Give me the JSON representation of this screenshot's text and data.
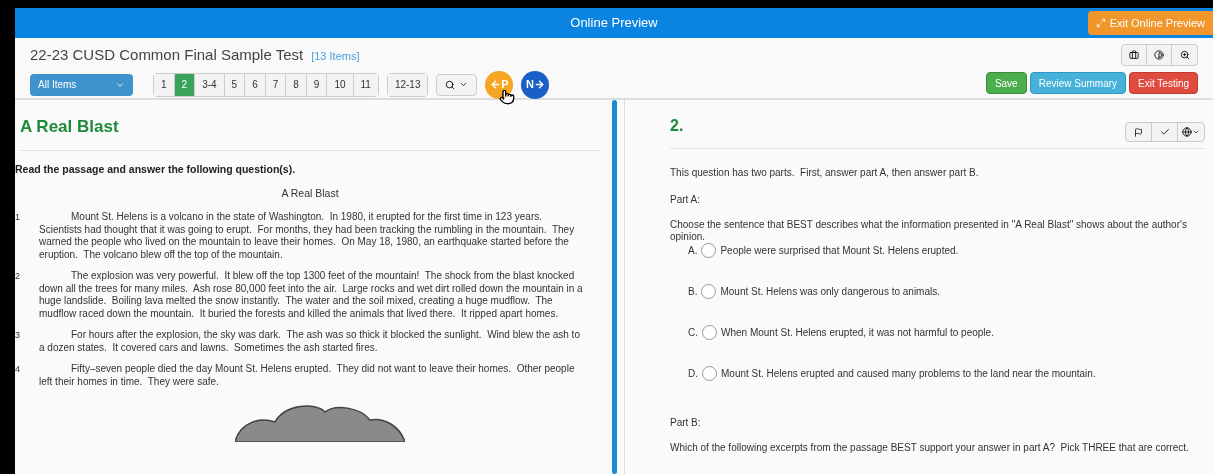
{
  "header": {
    "title": "Online Preview",
    "exit_button": "Exit Online Preview"
  },
  "test": {
    "title": "22-23 CUSD Common Final Sample Test",
    "count": "[13 Items]"
  },
  "filter": {
    "label": "All Items"
  },
  "pages": [
    {
      "label": "1",
      "selected": false
    },
    {
      "label": "2",
      "selected": true
    },
    {
      "label": "3-4",
      "selected": false
    },
    {
      "label": "5",
      "selected": false
    },
    {
      "label": "6",
      "selected": false
    },
    {
      "label": "7",
      "selected": false
    },
    {
      "label": "8",
      "selected": false
    },
    {
      "label": "9",
      "selected": false
    },
    {
      "label": "10",
      "selected": false
    },
    {
      "label": "11",
      "selected": false
    }
  ],
  "pages_extra": {
    "label": "12-13",
    "selected": false
  },
  "nav": {
    "prev": "P",
    "next": "N"
  },
  "actions": [
    {
      "label": "Save",
      "kind": "save"
    },
    {
      "label": "Review Summary",
      "kind": "review"
    },
    {
      "label": "Exit Testing",
      "kind": "exit"
    }
  ],
  "passage": {
    "heading": "A Real Blast",
    "instruction": "Read the passage and answer the following question(s).",
    "title": "A Real Blast",
    "paragraphs": [
      {
        "number": "1",
        "text": "Mount St. Helens is a volcano in the state of Washington.  In 1980, it erupted for the first time in 123 years.  Scientists had thought that it was going to erupt.  For months, they had been tracking the rumbling in the mountain.  They warned the people who lived on the mountain to leave their homes.  On May 18, 1980, an earthquake started before the eruption.  The volcano blew off the top of the mountain."
      },
      {
        "number": "2",
        "text": "The explosion was very powerful.  It blew off the top 1300 feet of the mountain!  The shock from the blast knocked down all the trees for many miles.  Ash rose 80,000 feet into the air.  Large rocks and wet dirt rolled down the mountain in a huge landslide.  Boiling lava melted the snow instantly.  The water and the soil mixed, creating a huge mudflow.  The mudflow raced down the mountain.  It buried the forests and killed the animals that lived there.  It ripped apart homes."
      },
      {
        "number": "3",
        "text": "For hours after the explosion, the sky was dark.  The ash was so thick it blocked the sunlight.  Wind blew the ash to a dozen states.  It covered cars and lawns.  Sometimes the ash started fires."
      },
      {
        "number": "4",
        "text": "Fifty–seven people died the day Mount St. Helens erupted.  They did not want to leave their homes.  Other people left their homes in time.  They were safe."
      }
    ]
  },
  "question": {
    "number": "2.",
    "intro": "This question has two parts.  First, answer part A, then answer part B.",
    "part_a": {
      "label": "Part A:",
      "prompt": "Choose the sentence that BEST describes what the information presented in \"A Real Blast\" shows about the author's opinion.",
      "options": [
        {
          "letter": "A.",
          "text": "People were surprised that Mount St. Helens erupted.",
          "selected": false
        },
        {
          "letter": "B.",
          "text": "Mount St. Helens was only dangerous to animals.",
          "selected": false
        },
        {
          "letter": "C.",
          "text": "When Mount St. Helens erupted, it was not harmful to people.",
          "selected": false
        },
        {
          "letter": "D.",
          "text": "Mount St. Helens erupted and caused many problems to the land near the mountain.",
          "selected": false
        }
      ]
    },
    "part_b": {
      "label": "Part B:",
      "prompt": "Which of the following excerpts from the passage BEST support your answer in part A?  Pick THREE that are correct."
    }
  }
}
